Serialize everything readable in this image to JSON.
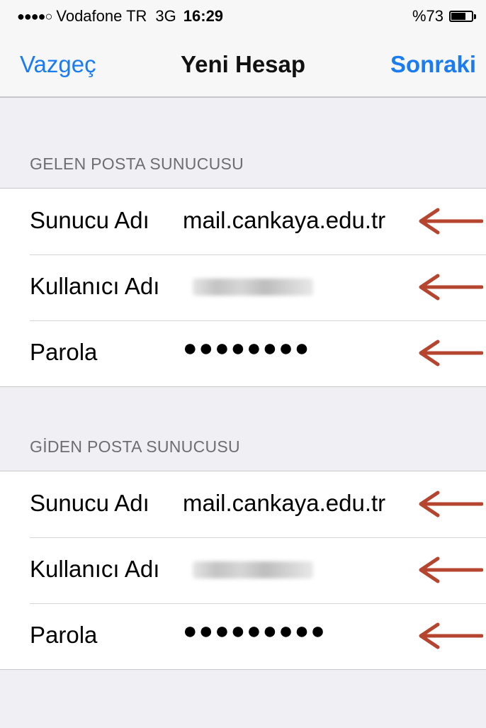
{
  "status_bar": {
    "signal": "●●●●○",
    "carrier": "Vodafone TR",
    "network": "3G",
    "time": "16:29",
    "battery_percent": "%73",
    "battery_level": 0.73
  },
  "nav": {
    "cancel_label": "Vazgeç",
    "title": "Yeni Hesap",
    "next_label": "Sonraki"
  },
  "incoming": {
    "header": "GELEN POSTA SUNUCUSU",
    "rows": [
      {
        "label": "Sunucu Adı",
        "value": "mail.cankaya.edu.tr"
      },
      {
        "label": "Kullanıcı Adı",
        "value": ""
      },
      {
        "label": "Parola",
        "value": "●●●●●●●●"
      }
    ]
  },
  "outgoing": {
    "header": "GİDEN POSTA SUNUCUSU",
    "rows": [
      {
        "label": "Sunucu Adı",
        "value": "mail.cankaya.edu.tr"
      },
      {
        "label": "Kullanıcı Adı",
        "value": ""
      },
      {
        "label": "Parola",
        "value": "●●●●●●●●●"
      }
    ]
  },
  "colors": {
    "accent": "#1a7cf0",
    "arrow": "#b5452f",
    "background": "#efeff4"
  },
  "icons": {
    "annotation_arrow": "left-arrow-icon",
    "battery": "battery-icon",
    "signal": "signal-dots-icon"
  }
}
